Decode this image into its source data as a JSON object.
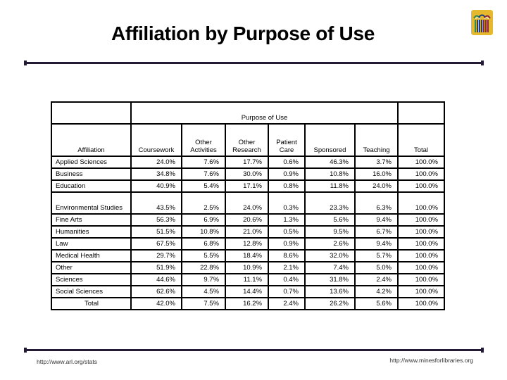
{
  "slide": {
    "title": "Affiliation by Purpose of Use",
    "logo_icon": "arl-library-arches-logo",
    "footer_left": "http://www.arl.org/stats",
    "footer_right": "http://www.minesforlibraries.org"
  },
  "table": {
    "group_header": "Purpose of Use",
    "row_header": "Affiliation",
    "columns": [
      "Coursework",
      "Other Activities",
      "Other Research",
      "Patient Care",
      "Sponsored",
      "Teaching",
      "Total"
    ],
    "rows": [
      {
        "label": "Applied Sciences",
        "values": [
          "24.0%",
          "7.6%",
          "17.7%",
          "0.6%",
          "46.3%",
          "3.7%",
          "100.0%"
        ]
      },
      {
        "label": "Business",
        "values": [
          "34.8%",
          "7.6%",
          "30.0%",
          "0.9%",
          "10.8%",
          "16.0%",
          "100.0%"
        ]
      },
      {
        "label": "Education",
        "values": [
          "40.9%",
          "5.4%",
          "17.1%",
          "0.8%",
          "11.8%",
          "24.0%",
          "100.0%"
        ]
      },
      {
        "label": "Environmental Studies",
        "values": [
          "43.5%",
          "2.5%",
          "24.0%",
          "0.3%",
          "23.3%",
          "6.3%",
          "100.0%"
        ]
      },
      {
        "label": "Fine Arts",
        "values": [
          "56.3%",
          "6.9%",
          "20.6%",
          "1.3%",
          "5.6%",
          "9.4%",
          "100.0%"
        ]
      },
      {
        "label": "Humanities",
        "values": [
          "51.5%",
          "10.8%",
          "21.0%",
          "0.5%",
          "9.5%",
          "6.7%",
          "100.0%"
        ]
      },
      {
        "label": "Law",
        "values": [
          "67.5%",
          "6.8%",
          "12.8%",
          "0.9%",
          "2.6%",
          "9.4%",
          "100.0%"
        ]
      },
      {
        "label": "Medical Health",
        "values": [
          "29.7%",
          "5.5%",
          "18.4%",
          "8.6%",
          "32.0%",
          "5.7%",
          "100.0%"
        ]
      },
      {
        "label": "Other",
        "values": [
          "51.9%",
          "22.8%",
          "10.9%",
          "2.1%",
          "7.4%",
          "5.0%",
          "100.0%"
        ]
      },
      {
        "label": "Sciences",
        "values": [
          "44.6%",
          "9.7%",
          "11.1%",
          "0.4%",
          "31.8%",
          "2.4%",
          "100.0%"
        ]
      },
      {
        "label": "Social Sciences",
        "values": [
          "62.6%",
          "4.5%",
          "14.4%",
          "0.7%",
          "13.6%",
          "4.2%",
          "100.0%"
        ]
      }
    ],
    "total_row": {
      "label": "Total",
      "values": [
        "42.0%",
        "7.5%",
        "16.2%",
        "2.4%",
        "26.2%",
        "5.6%",
        "100.0%"
      ]
    }
  }
}
